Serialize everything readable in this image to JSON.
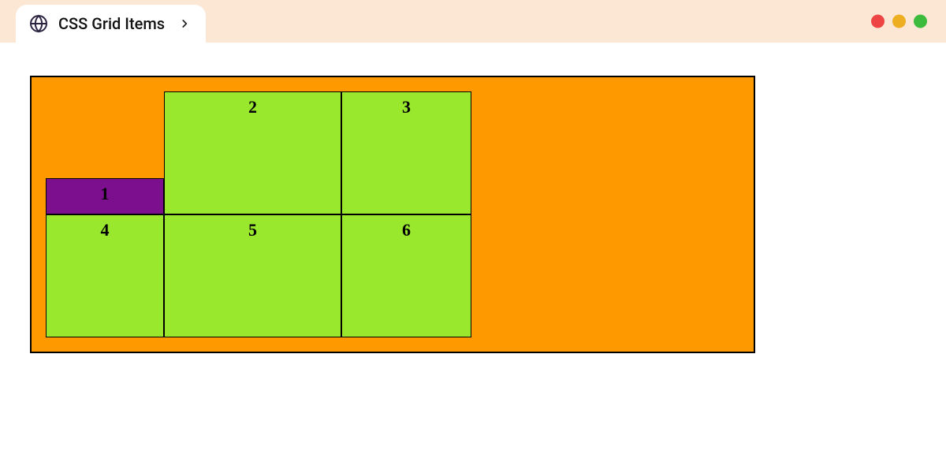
{
  "tab": {
    "title": "CSS Grid Items"
  },
  "window_controls": {
    "close": "close",
    "minimize": "minimize",
    "maximize": "maximize"
  },
  "grid": {
    "items": [
      {
        "label": "1"
      },
      {
        "label": "2"
      },
      {
        "label": "3"
      },
      {
        "label": "4"
      },
      {
        "label": "5"
      },
      {
        "label": "6"
      }
    ]
  },
  "colors": {
    "titlebar_bg": "#FCE7D4",
    "container_bg": "#FF9900",
    "cell_bg": "#9AE82E",
    "highlight_bg": "#7B0F8E",
    "border": "#000000"
  }
}
